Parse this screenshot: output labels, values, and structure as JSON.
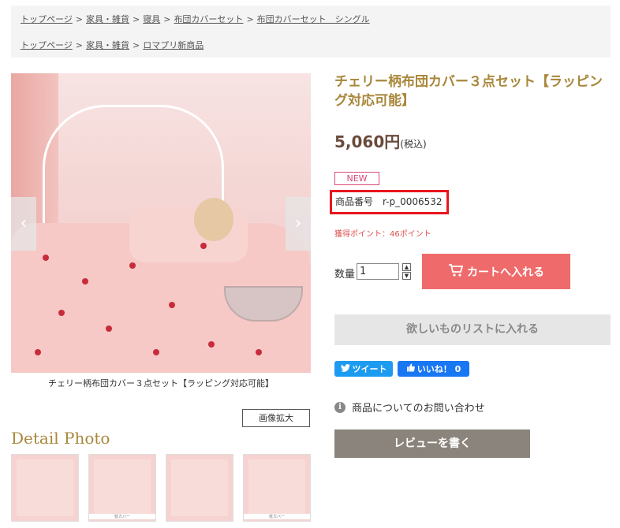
{
  "breadcrumbs": {
    "row1": [
      "トップページ",
      "家具・雑貨",
      "寝具",
      "布団カバーセット",
      "布団カバーセット　シングル"
    ],
    "row2": [
      "トップページ",
      "家具・雑貨",
      "ロマプリ新商品"
    ],
    "separator": ">"
  },
  "gallery": {
    "caption": "チェリー柄布団カバー３点セット【ラッピング対応可能】",
    "zoom_label": "画像拡大",
    "prev_icon": "‹",
    "next_icon": "›"
  },
  "detail": {
    "title": "Detail Photo",
    "thumbs": [
      {
        "label": ""
      },
      {
        "label": "枕カバー"
      },
      {
        "label": ""
      },
      {
        "label": "枕カバー"
      }
    ]
  },
  "product": {
    "title": "チェリー柄布団カバー３点セット【ラッピング対応可能】",
    "price": "5,060円",
    "tax": "(税込)",
    "badge": "NEW",
    "sku": "商品番号　r-p_0006532",
    "points": "獲得ポイント：46ポイント",
    "qty_label": "数量",
    "qty_value": "1",
    "cart_label": "カートへ入れる",
    "wishlist_label": "欲しいものリストに入れる",
    "tweet_label": "ツイート",
    "like_label": "いいね！ 0",
    "inquiry_label": "商品についてのお問い合わせ",
    "review_label": "レビューを書く"
  },
  "colors": {
    "accent_gold": "#a8873a",
    "cart": "#ef6b6b",
    "highlight": "#e8171d",
    "twitter": "#1d9bf0",
    "facebook": "#1877f2"
  }
}
